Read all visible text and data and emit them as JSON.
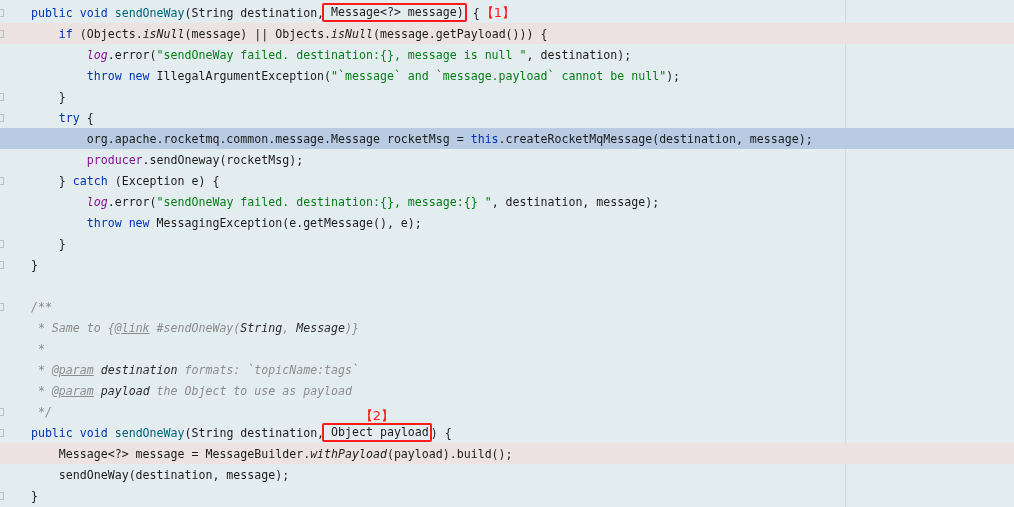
{
  "editor": {
    "lines": [
      {
        "kind": "plain",
        "fold": true,
        "segments": [
          {
            "kind": "code",
            "tokens": [
              {
                "text": "    public void ",
                "kind": "keyword"
              },
              {
                "text": "sendOneWay",
                "kind": "method"
              },
              {
                "text": "(String destination,",
                "kind": "plain"
              }
            ]
          },
          {
            "kind": "boxed",
            "tokens": [
              {
                "text": " Message<?> message)",
                "kind": "plain"
              }
            ]
          },
          {
            "kind": "code",
            "tokens": [
              {
                "text": " {",
                "kind": "plain"
              }
            ]
          },
          {
            "kind": "label",
            "text": "【1】"
          }
        ]
      },
      {
        "kind": "marked",
        "fold": true,
        "segments": [
          {
            "kind": "code",
            "tokens": [
              {
                "text": "        if",
                "kind": "keyword"
              },
              {
                "text": " (Objects.",
                "kind": "plain"
              },
              {
                "text": "isNull",
                "kind": "static"
              },
              {
                "text": "(message) || Objects.",
                "kind": "plain"
              },
              {
                "text": "isNull",
                "kind": "static"
              },
              {
                "text": "(message.getPayload())) {",
                "kind": "plain"
              }
            ]
          }
        ]
      },
      {
        "kind": "plain",
        "fold": false,
        "segments": [
          {
            "kind": "code",
            "tokens": [
              {
                "text": "            log",
                "kind": "field"
              },
              {
                "text": ".error(",
                "kind": "plain"
              },
              {
                "text": "\"sendOneWay failed. destination:{}, message is null \"",
                "kind": "string"
              },
              {
                "text": ", destination);",
                "kind": "plain"
              }
            ]
          }
        ]
      },
      {
        "kind": "plain",
        "fold": false,
        "segments": [
          {
            "kind": "code",
            "tokens": [
              {
                "text": "            throw new ",
                "kind": "keyword"
              },
              {
                "text": "IllegalArgumentException(",
                "kind": "plain"
              },
              {
                "text": "\"`message` and `message.payload` cannot be null\"",
                "kind": "string"
              },
              {
                "text": ");",
                "kind": "plain"
              }
            ]
          }
        ]
      },
      {
        "kind": "plain",
        "fold": true,
        "segments": [
          {
            "kind": "code",
            "tokens": [
              {
                "text": "        }",
                "kind": "plain"
              }
            ]
          }
        ]
      },
      {
        "kind": "plain",
        "fold": true,
        "segments": [
          {
            "kind": "code",
            "tokens": [
              {
                "text": "        try",
                "kind": "keyword"
              },
              {
                "text": " {",
                "kind": "plain"
              }
            ]
          }
        ]
      },
      {
        "kind": "current",
        "fold": false,
        "segments": [
          {
            "kind": "code",
            "tokens": [
              {
                "text": "            org.apache.rocketmq.common.message.Message rocketMsg = ",
                "kind": "plain"
              },
              {
                "text": "this",
                "kind": "keyword"
              },
              {
                "text": ".createRocketMqMessage(destination, message);",
                "kind": "plain"
              }
            ]
          }
        ]
      },
      {
        "kind": "plain",
        "fold": false,
        "segments": [
          {
            "kind": "code",
            "tokens": [
              {
                "text": "            producer",
                "kind": "member"
              },
              {
                "text": ".sendOneway(rocketMsg);",
                "kind": "plain"
              }
            ]
          }
        ]
      },
      {
        "kind": "plain",
        "fold": true,
        "segments": [
          {
            "kind": "code",
            "tokens": [
              {
                "text": "        } ",
                "kind": "plain"
              },
              {
                "text": "catch",
                "kind": "keyword"
              },
              {
                "text": " (Exception e) {",
                "kind": "plain"
              }
            ]
          }
        ]
      },
      {
        "kind": "plain",
        "fold": false,
        "segments": [
          {
            "kind": "code",
            "tokens": [
              {
                "text": "            log",
                "kind": "field"
              },
              {
                "text": ".error(",
                "kind": "plain"
              },
              {
                "text": "\"sendOneWay failed. destination:{}, message:{} \"",
                "kind": "string"
              },
              {
                "text": ", destination, message);",
                "kind": "plain"
              }
            ]
          }
        ]
      },
      {
        "kind": "plain",
        "fold": false,
        "segments": [
          {
            "kind": "code",
            "tokens": [
              {
                "text": "            throw new ",
                "kind": "keyword"
              },
              {
                "text": "MessagingException(e.getMessage(), e);",
                "kind": "plain"
              }
            ]
          }
        ]
      },
      {
        "kind": "plain",
        "fold": true,
        "segments": [
          {
            "kind": "code",
            "tokens": [
              {
                "text": "        }",
                "kind": "plain"
              }
            ]
          }
        ]
      },
      {
        "kind": "plain",
        "fold": true,
        "segments": [
          {
            "kind": "code",
            "tokens": [
              {
                "text": "    }",
                "kind": "plain"
              }
            ]
          }
        ]
      },
      {
        "kind": "plain",
        "fold": false
      },
      {
        "kind": "plain",
        "fold": true,
        "segments": [
          {
            "kind": "code",
            "tokens": [
              {
                "text": "    /**",
                "kind": "comment"
              }
            ]
          }
        ]
      },
      {
        "kind": "plain",
        "fold": false,
        "segments": [
          {
            "kind": "code",
            "tokens": [
              {
                "text": "     * Same to {",
                "kind": "comment"
              },
              {
                "text": "@link",
                "kind": "doctag"
              },
              {
                "text": " #sendOneWay(",
                "kind": "comment"
              },
              {
                "text": "String",
                "kind": "docref"
              },
              {
                "text": ", ",
                "kind": "comment"
              },
              {
                "text": "Message",
                "kind": "docref"
              },
              {
                "text": ")}",
                "kind": "comment"
              }
            ]
          }
        ]
      },
      {
        "kind": "plain",
        "fold": false,
        "segments": [
          {
            "kind": "code",
            "tokens": [
              {
                "text": "     *",
                "kind": "comment"
              }
            ]
          }
        ]
      },
      {
        "kind": "plain",
        "fold": false,
        "segments": [
          {
            "kind": "code",
            "tokens": [
              {
                "text": "     * ",
                "kind": "comment"
              },
              {
                "text": "@param",
                "kind": "doctag"
              },
              {
                "text": " destination",
                "kind": "docref"
              },
              {
                "text": " formats: `topicName:tags`",
                "kind": "comment"
              }
            ]
          }
        ]
      },
      {
        "kind": "plain",
        "fold": false,
        "segments": [
          {
            "kind": "code",
            "tokens": [
              {
                "text": "     * ",
                "kind": "comment"
              },
              {
                "text": "@param",
                "kind": "doctag"
              },
              {
                "text": " payload",
                "kind": "docref"
              },
              {
                "text": " the Object to use as payload",
                "kind": "comment"
              }
            ]
          }
        ]
      },
      {
        "kind": "plain",
        "fold": true,
        "segments": [
          {
            "kind": "code",
            "tokens": [
              {
                "text": "     */",
                "kind": "comment"
              }
            ]
          }
        ]
      },
      {
        "kind": "plain",
        "fold": true,
        "segments": [
          {
            "kind": "code",
            "tokens": [
              {
                "text": "    public void ",
                "kind": "keyword"
              },
              {
                "text": "sendOneWay",
                "kind": "method"
              },
              {
                "text": "(String destination,",
                "kind": "plain"
              }
            ]
          },
          {
            "kind": "boxed",
            "tokens": [
              {
                "text": " Object payload",
                "kind": "plain"
              }
            ],
            "label": "【2】"
          },
          {
            "kind": "code",
            "tokens": [
              {
                "text": ") {",
                "kind": "plain"
              }
            ]
          }
        ]
      },
      {
        "kind": "marked",
        "fold": false,
        "segments": [
          {
            "kind": "code",
            "tokens": [
              {
                "text": "        Message<?> message = MessageBuilder.",
                "kind": "plain"
              },
              {
                "text": "withPayload",
                "kind": "static"
              },
              {
                "text": "(payload).build();",
                "kind": "plain"
              }
            ]
          }
        ]
      },
      {
        "kind": "plain",
        "fold": false,
        "segments": [
          {
            "kind": "code",
            "tokens": [
              {
                "text": "        sendOneWay(destination, message);",
                "kind": "plain"
              }
            ]
          }
        ]
      },
      {
        "kind": "plain",
        "fold": true,
        "segments": [
          {
            "kind": "code",
            "tokens": [
              {
                "text": "    }",
                "kind": "plain"
              }
            ]
          }
        ]
      }
    ]
  }
}
